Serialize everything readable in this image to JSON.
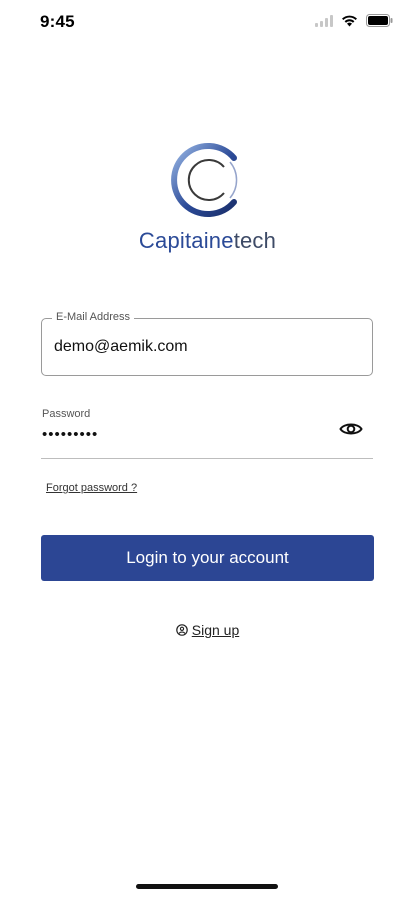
{
  "status_bar": {
    "time": "9:45",
    "icons": [
      "signal-icon",
      "wifi-icon",
      "battery-icon"
    ]
  },
  "logo": {
    "text_part1": "Capitaine",
    "text_part2": "tech"
  },
  "login_form": {
    "email_label": "E-Mail Address",
    "email_value": "demo@aemik.com",
    "password_label": "Password",
    "password_value": "•••••••••",
    "forgot_password": "Forgot password ?",
    "login_button": "Login to your account",
    "signup_label": "Sign up"
  },
  "colors": {
    "primary": "#2c4694",
    "logo_blue": "#2b4a97",
    "border": "#9a9a9a"
  }
}
